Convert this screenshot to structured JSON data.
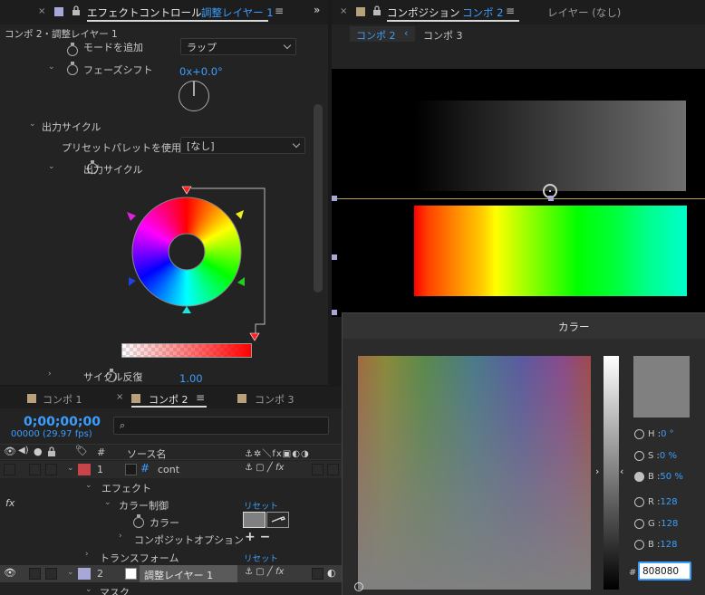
{
  "effect_panel": {
    "title": "エフェクトコントロール",
    "layer_name": "調整レイヤー 1",
    "breadcrumb": "コンポ 2・調整レイヤー 1",
    "mode_label": "モードを追加",
    "mode_value": "ラップ",
    "phase_label": "フェーズシフト",
    "phase_value": "0x+0.0°",
    "output_cycle_group": "出力サイクル",
    "preset_label": "プリセットパレットを使用",
    "preset_value": "[なし]",
    "output_cycle_prop": "出力サイクル",
    "cycle_repeat_label": "サイクル反復",
    "cycle_repeat_value": "1.00"
  },
  "composition_panel": {
    "title": "コンポジション",
    "comp_name": "コンポ 2",
    "layer_tab": "レイヤー (なし)",
    "nav_current": "コンポ 2",
    "nav_next": "コンポ 3"
  },
  "timeline": {
    "tabs": [
      {
        "label": "コンポ 1",
        "color": "#b8a07a"
      },
      {
        "label": "コンポ 2",
        "color": "#b8a07a"
      },
      {
        "label": "コンポ 3",
        "color": "#b8a07a"
      }
    ],
    "timecode": "0;00;00;00",
    "fps": "00000 (29.97 fps)",
    "search_placeholder": "",
    "col_num": "#",
    "col_source": "ソース名",
    "layers": [
      {
        "num": "1",
        "name": "cont",
        "label_color": "#c8444a"
      },
      {
        "num": "2",
        "name": "調整レイヤー 1",
        "label_color": "#a8a8d8"
      }
    ],
    "effect_group": "エフェクト",
    "color_control": "カラー制御",
    "reset1": "リセット",
    "color_prop": "カラー",
    "composite_option": "コンポジットオプション",
    "plusminus": "+ −",
    "transform": "トランスフォーム",
    "reset2": "リセット",
    "mask": "マスク",
    "fx": "fx"
  },
  "color_dialog": {
    "title": "カラー",
    "h_label": "H :",
    "h_value": "0 °",
    "s_label": "S :",
    "s_value": "0 %",
    "b_label": "B :",
    "b_value": "50 %",
    "r_label": "R :",
    "r_value": "128",
    "g_label": "G :",
    "g_value": "128",
    "bl_label": "B :",
    "bl_value": "128",
    "hash": "#",
    "hex_value": "808080",
    "preview_color": "#808080"
  },
  "colors": {
    "accent": "#3b9eff",
    "swatch_lavender": "#a8a8d8",
    "swatch_tan": "#b8a07a"
  }
}
